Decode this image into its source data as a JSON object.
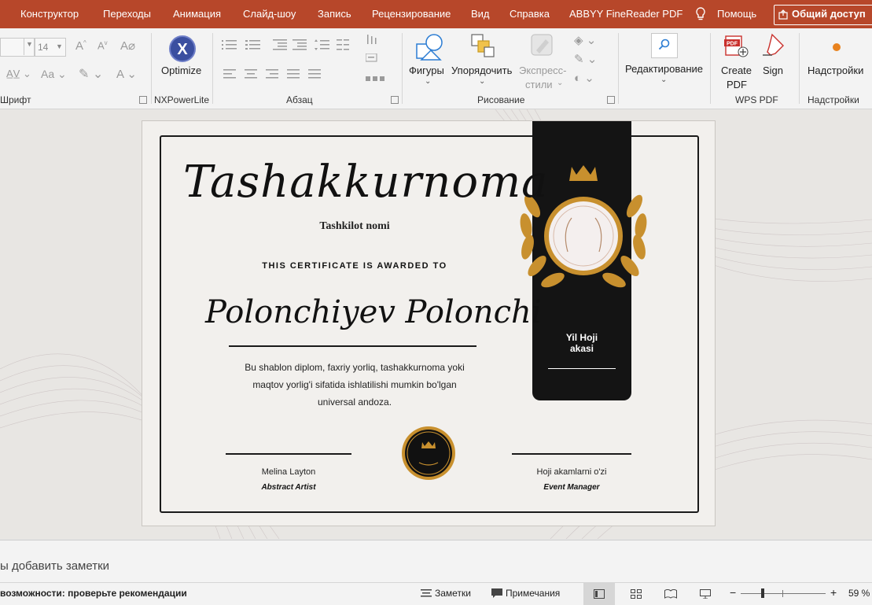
{
  "tabs": [
    "Конструктор",
    "Переходы",
    "Анимация",
    "Слайд-шоу",
    "Запись",
    "Рецензирование",
    "Вид",
    "Справка",
    "ABBYY FineReader PDF",
    "Помощь"
  ],
  "share_label": "Общий доступ",
  "ribbon": {
    "font_size": "14",
    "groups": {
      "font": "Шрифт",
      "nxpowerlite": "NXPowerLite",
      "paragraph": "Абзац",
      "drawing": "Рисование",
      "wps_pdf": "WPS PDF",
      "addins": "Надстройки"
    },
    "buttons": {
      "optimize": "Optimize",
      "shapes": "Фигуры",
      "arrange": "Упорядочить",
      "express1": "Экспресс-",
      "express2": "стили",
      "editing": "Редактирование",
      "create_pdf1": "Create",
      "create_pdf2": "PDF",
      "sign": "Sign",
      "addins": "Надстройки"
    }
  },
  "certificate": {
    "title": "Tashakkurnoma",
    "org_name": "Tashkilot nomi",
    "awarded_to": "THIS CERTIFICATE IS AWARDED TO",
    "recipient": "Polonchiyev Polonchi",
    "description_lines": [
      "Bu shablon diplom, faxriy yorliq, tashakkurnoma yoki",
      "maqtov yorlig'i sifatida ishlatilishi mumkin bo'lgan",
      "universal andoza."
    ],
    "banner_lines": [
      "Yil Hoji",
      "akasi"
    ],
    "signer_left_name": "Melina Layton",
    "signer_left_role": "Abstract Artist",
    "signer_right_name": "Hoji akamlarni o'zi",
    "signer_right_role": "Event Manager"
  },
  "notes_placeholder": "ы добавить заметки",
  "status": {
    "accessibility": "возможности: проверьте рекомендации",
    "notes": "Заметки",
    "comments": "Примечания",
    "zoom_minus": "−",
    "zoom_plus": "+",
    "zoom": "59 %"
  },
  "colors": {
    "tab_bar": "#b7472a",
    "banner": "#141414",
    "gold": "#c8902e"
  }
}
